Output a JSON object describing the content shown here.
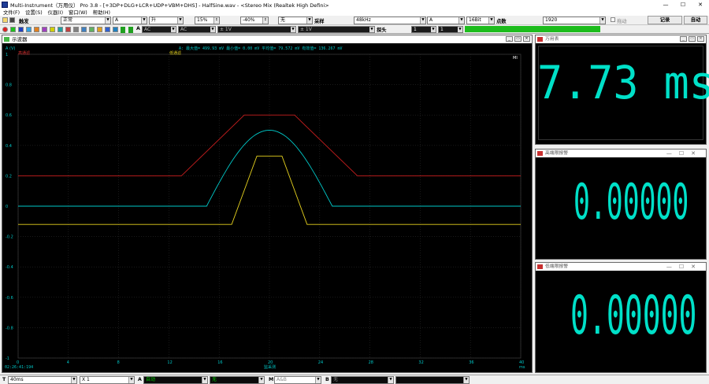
{
  "window": {
    "title": "Multi-Instrument（万用仪） Pro 3.8  -  [+3DP+DLG+LCR+UDP+VBM+DHS]  -  HalfSine.wav  -  <Stereo Mix (Realtek High Defini>"
  },
  "menu": [
    "文件(F)",
    "设置(S)",
    "仪器(I)",
    "窗口(W)",
    "帮助(H)"
  ],
  "toolbar1": {
    "trigger_label": "触发",
    "trigger_mode": "正常",
    "channel": "A",
    "edge": "升",
    "level": "15%",
    "pretrig": "-40%",
    "none1": "无",
    "sample_label": "采样",
    "sample_rate": "48kHz",
    "channel2": "A",
    "bits": "16Bit",
    "points_label": "点数",
    "points": "1920",
    "drag_label": "拖动",
    "record_btn": "记录",
    "auto_btn": "自动"
  },
  "toolbar2": {
    "coupling_a": "AC",
    "coupling_b": "AC",
    "range_a": "± 1V",
    "range_b": "± 1V",
    "probe_label": "探头",
    "probe_a": "1",
    "probe_b": "1"
  },
  "scope": {
    "title": "示波器",
    "unit": "A (V)",
    "legend_red": "高通滤",
    "legend_yellow": "低通滤",
    "stats": "A: 最大值= 499.93 mV  最小值=  0.00 mV  平均值=  79.572 mV  有效值=  136.267 mV",
    "time_start": "02:26:41:194",
    "xunit": "ms",
    "xlabel": "监采测"
  },
  "chart_data": {
    "type": "line",
    "title": "",
    "xlabel": "监采测",
    "ylabel": "A (V)",
    "xlim": [
      0,
      40
    ],
    "ylim": [
      -1,
      1
    ],
    "x_ticks": [
      "0",
      "4",
      "8",
      "12",
      "16",
      "20",
      "24",
      "28",
      "32",
      "36",
      "40"
    ],
    "y_ticks": [
      "1",
      "0.8",
      "0.6",
      "0.4",
      "0.2",
      "0",
      "-0.2",
      "-0.4",
      "-0.6",
      "-0.8",
      "-1"
    ],
    "grid": true,
    "series": [
      {
        "name": "高通滤",
        "color": "#c81e1e",
        "x": [
          0,
          13,
          18,
          22,
          27,
          40
        ],
        "y": [
          0.2,
          0.2,
          0.6,
          0.6,
          0.2,
          0.2
        ]
      },
      {
        "name": "",
        "color": "#00c8c8",
        "x": [
          0,
          15,
          16,
          17,
          18,
          19,
          20,
          21,
          22,
          23,
          24,
          25,
          40
        ],
        "y": [
          0,
          0,
          0.12,
          0.28,
          0.4,
          0.47,
          0.5,
          0.47,
          0.4,
          0.28,
          0.12,
          0,
          0
        ]
      },
      {
        "name": "低通滤",
        "color": "#e6d21e",
        "x": [
          0,
          17,
          19,
          21,
          23,
          40
        ],
        "y": [
          -0.12,
          -0.12,
          0.33,
          0.33,
          -0.12,
          -0.12
        ]
      }
    ]
  },
  "panels": {
    "meter_title": "万用表",
    "meter_value": "7.73 ms",
    "alarm_high_title": "高端限报警",
    "alarm_high_value": "0.00000",
    "alarm_low_title": "低端限报警",
    "alarm_low_value": "0.00000"
  },
  "statusbar": {
    "t_label": "T",
    "timebase": "40ms",
    "multiplier": "X 1",
    "a_label": "A",
    "a_mode": "自动",
    "a_none": "无",
    "m_label": "M",
    "m_mode": "A&B",
    "b_label": "B",
    "b_none": "无"
  }
}
